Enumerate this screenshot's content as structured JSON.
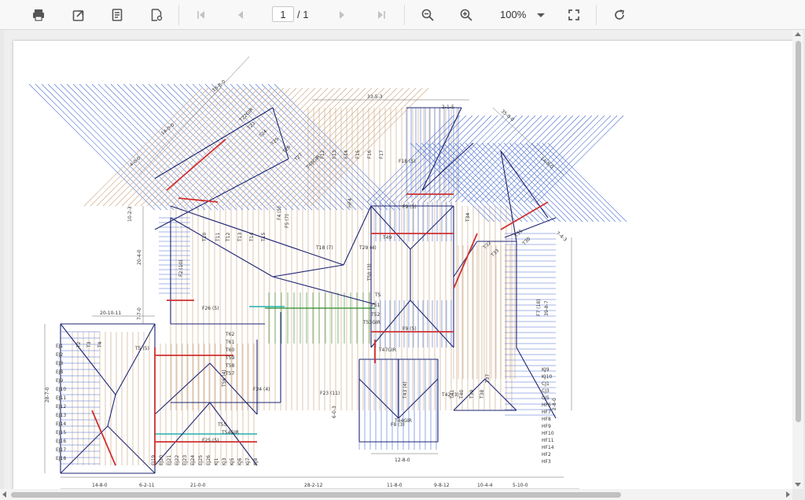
{
  "toolbar": {
    "buttons": [
      {
        "name": "print-button",
        "icon": "print-icon"
      },
      {
        "name": "download-button",
        "icon": "export-icon"
      },
      {
        "name": "document-properties-button",
        "icon": "document-icon"
      },
      {
        "name": "document-settings-button",
        "icon": "file-settings-icon"
      },
      {
        "name": "first-page-button",
        "icon": "first-page-icon"
      },
      {
        "name": "previous-page-button",
        "icon": "previous-page-icon"
      },
      {
        "name": "next-page-button",
        "icon": "next-page-icon"
      },
      {
        "name": "last-page-button",
        "icon": "last-page-icon"
      },
      {
        "name": "zoom-out-button",
        "icon": "zoom-out-icon"
      },
      {
        "name": "zoom-in-button",
        "icon": "zoom-in-icon"
      },
      {
        "name": "fit-page-button",
        "icon": "fullscreen-icon"
      },
      {
        "name": "refresh-button",
        "icon": "refresh-icon"
      }
    ],
    "page_current": "1",
    "page_total": "/ 1",
    "zoom": "100%"
  },
  "colors": {
    "truss_brown": "#c9a17a",
    "truss_blue": "#4a6fd1",
    "girder_red": "#d03030",
    "ridge_navy": "#1d2573",
    "member_green": "#2a8a2a",
    "dim_line": "#666666"
  },
  "plan": {
    "labels": {
      "dims_top": [
        "18-8-0",
        "14-0-0",
        "4-0-0",
        "33-5-3",
        "2-1-5",
        "35-0-0",
        "14-8-0",
        "7-4-3"
      ],
      "dims_left": [
        "20-4-0",
        "7-7-0",
        "20-10-11",
        "28-7-0",
        "6-0-3",
        "10-2-3"
      ],
      "dims_bottom": [
        "14-8-0",
        "6-2-11",
        "21-0-0",
        "28-2-12",
        "11-8-0",
        "9-8-12",
        "10-4-4",
        "5-10-0",
        "12-8-0"
      ],
      "dims_right": [
        "39-8-7",
        "2-8-0"
      ],
      "trusses": [
        "F12",
        "F13",
        "F14",
        "F15",
        "F16",
        "F17",
        "F18 (5)",
        "F9 (5)",
        "F2 (10)",
        "F26 (5)",
        "F24 (4)",
        "F23 (11)",
        "F25 (5)",
        "F8 (3)",
        "F7 (18)",
        "F9 (5)",
        "F4 (5)",
        "F5 (7)",
        "T5 (5)",
        "T22GIR",
        "T23",
        "T24",
        "T25",
        "T26",
        "T27",
        "T48GIR",
        "T49",
        "T18 (7)",
        "T29 (4)",
        "T50 (3)",
        "T51",
        "T52",
        "T53GIR",
        "T47GIR",
        "T44GIR",
        "T43 (4)",
        "T42 (3)",
        "T41",
        "T40",
        "T39",
        "T38",
        "T37",
        "T62",
        "T61",
        "T60",
        "T59",
        "T58",
        "T57",
        "T56 (4)",
        "T55",
        "T54GIR",
        "T2",
        "T3",
        "T4",
        "T10",
        "T11",
        "T12",
        "T13",
        "T14",
        "T15",
        "T31",
        "T30",
        "T32",
        "T33",
        "T34",
        "TS"
      ],
      "jacks": [
        "EJ1",
        "EJ2",
        "EJ3",
        "EJ8",
        "EJ9",
        "EJ10",
        "EJ11",
        "EJ12",
        "EJ13",
        "EJ14",
        "EJ15",
        "EJ16",
        "EJ17",
        "EJ18",
        "EJ19",
        "EJ20",
        "EJ21",
        "EJ22",
        "EJ23",
        "EJ24",
        "EJ25",
        "EJ26",
        "KJ1",
        "KJ3",
        "KJ5",
        "KJ6",
        "KJ7",
        "KJ8",
        "KJ9",
        "KJ10",
        "CJ1",
        "CJ3",
        "CJ5",
        "HF6",
        "HF7",
        "HF8",
        "HF9",
        "HF10",
        "HF11",
        "HF14",
        "HF2",
        "HF3",
        "HF4"
      ]
    }
  }
}
